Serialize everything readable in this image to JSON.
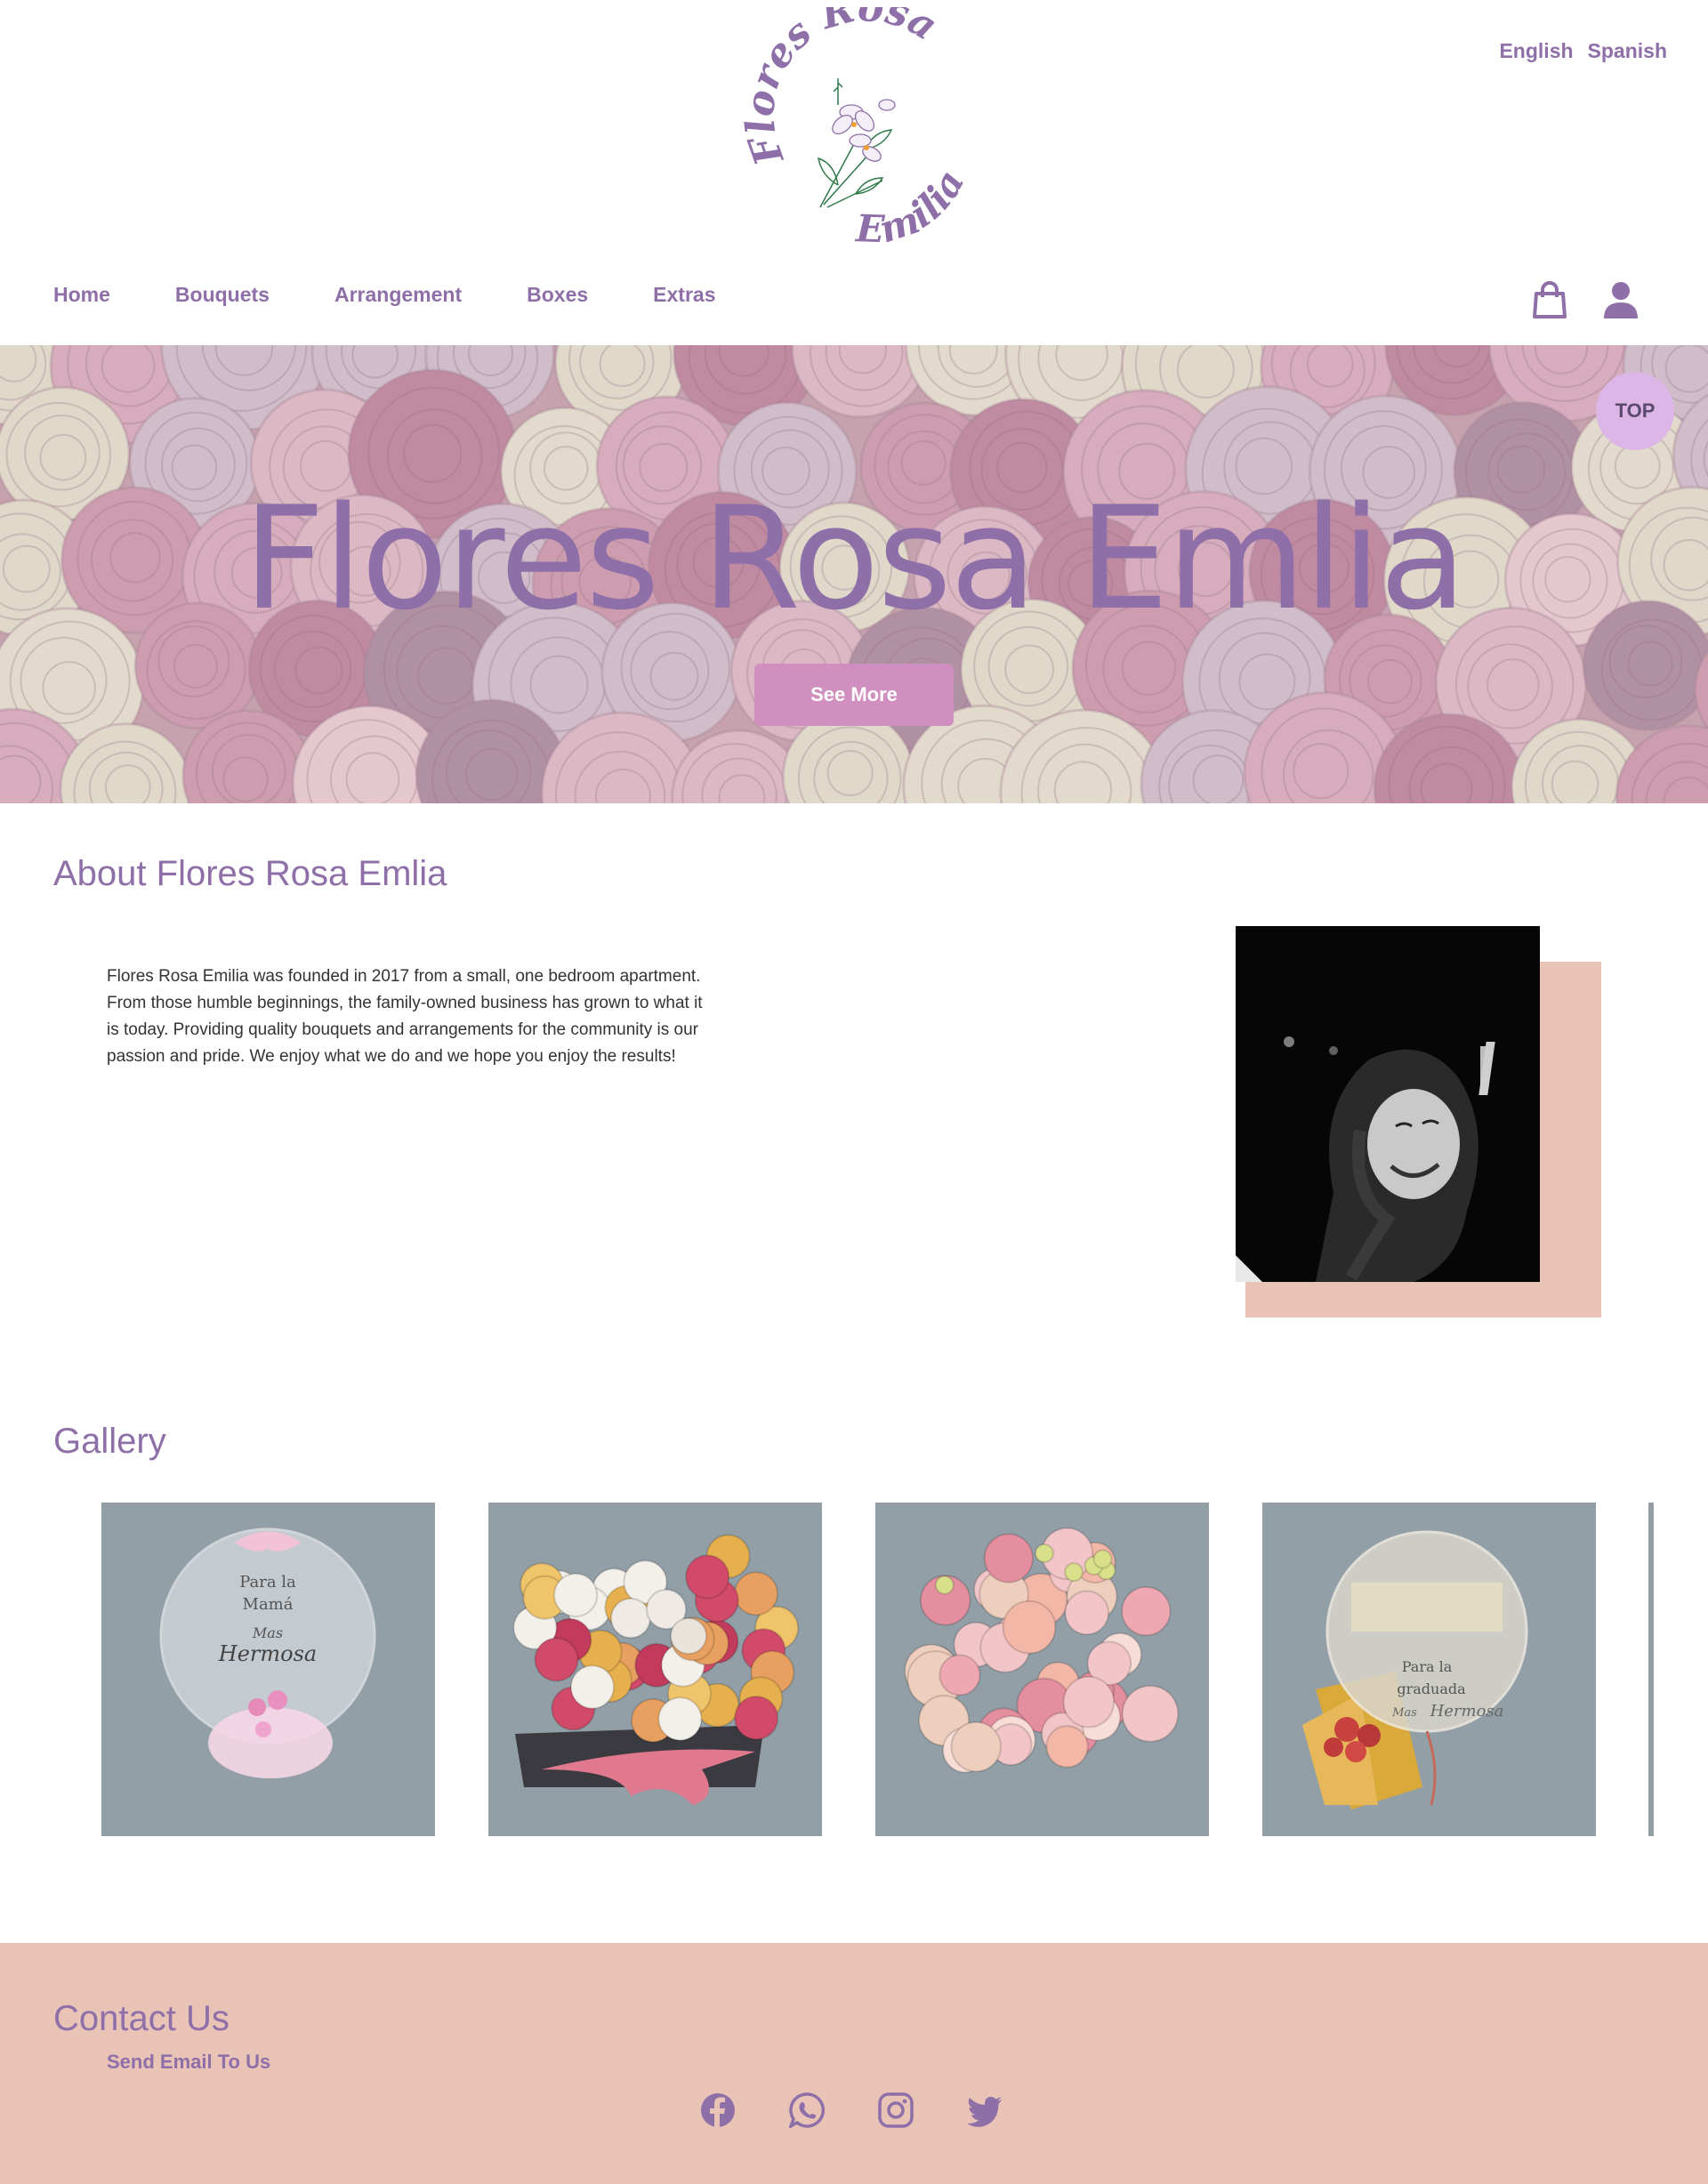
{
  "header": {
    "logo_text_top": "Flores Rosa",
    "logo_text_bottom": "Emilia",
    "languages": [
      "English",
      "Spanish"
    ]
  },
  "nav": {
    "items": [
      "Home",
      "Bouquets",
      "Arrangement",
      "Boxes",
      "Extras"
    ],
    "icons": [
      "shopping-bag-icon",
      "user-icon"
    ]
  },
  "hero": {
    "title": "Flores Rosa Emlia",
    "button": "See More",
    "top_button": "TOP"
  },
  "about": {
    "title": "About Flores Rosa Emlia",
    "text": "Flores Rosa Emilia was founded in 2017 from a small, one bedroom apartment. From those humble beginnings, the family-owned business has grown to what it is today. Providing quality bouquets and arrangements for the community is our passion and pride. We enjoy what we do and we hope you enjoy the results!"
  },
  "gallery": {
    "title": "Gallery",
    "items": [
      {
        "balloon_text": [
          "Para la",
          "Mamá",
          "Mas",
          "Hermosa"
        ]
      },
      {},
      {},
      {
        "balloon_text": [
          "Para la",
          "graduada",
          "Mas",
          "Hermosa"
        ]
      }
    ]
  },
  "footer": {
    "title": "Contact Us",
    "send_email": "Send Email To Us",
    "socials": [
      "facebook-icon",
      "whatsapp-icon",
      "instagram-icon",
      "twitter-icon"
    ]
  },
  "colors": {
    "brand_purple": "#8e6fa8",
    "button_pink": "#d08fbf",
    "accent_peach": "#e8c3b6",
    "top_button": "#dcb6e6",
    "gallery_tile": "#929fa6"
  }
}
